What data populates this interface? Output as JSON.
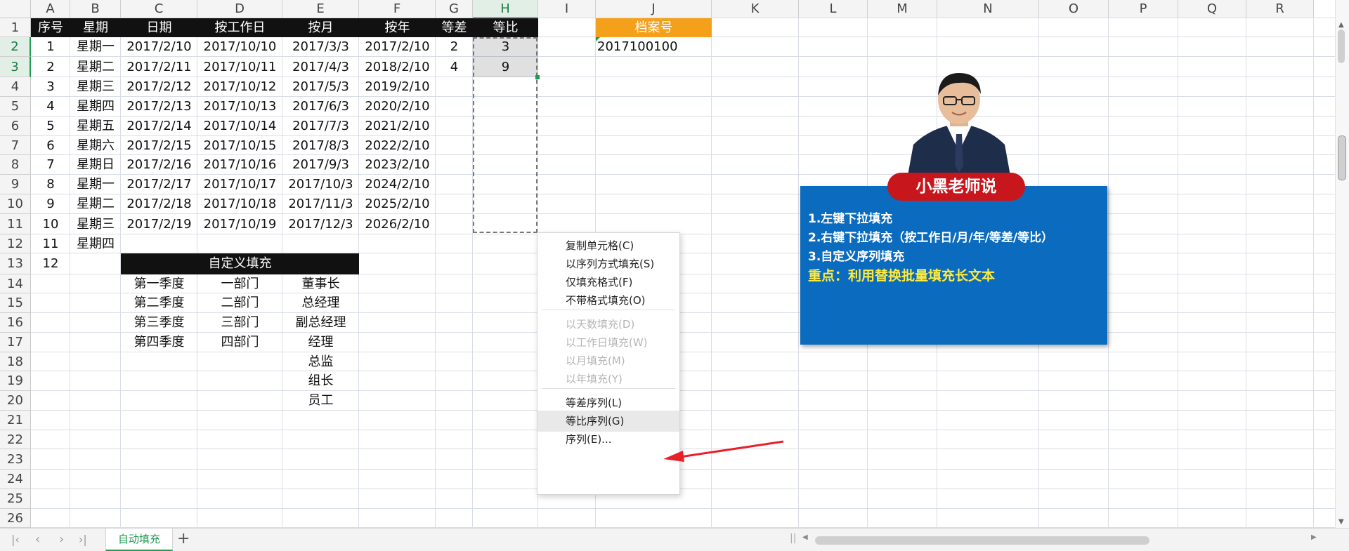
{
  "column_headers": [
    "A",
    "B",
    "C",
    "D",
    "E",
    "F",
    "G",
    "H",
    "I",
    "J",
    "K",
    "L",
    "M",
    "N",
    "O",
    "P",
    "Q",
    "R"
  ],
  "selected_column": "H",
  "row_headers": [
    "1",
    "2",
    "3",
    "4",
    "5",
    "6",
    "7",
    "8",
    "9",
    "10",
    "11",
    "12",
    "13",
    "14",
    "15",
    "16",
    "17",
    "18",
    "19",
    "20",
    "21",
    "22",
    "23",
    "24",
    "25",
    "26"
  ],
  "selected_rows": [
    "2",
    "3"
  ],
  "table_header": [
    "序号",
    "星期",
    "日期",
    "按工作日",
    "按月",
    "按年",
    "等差",
    "等比"
  ],
  "rows": [
    [
      "1",
      "星期一",
      "2017/2/10",
      "2017/10/10",
      "2017/3/3",
      "2017/2/10",
      "2",
      "3"
    ],
    [
      "2",
      "星期二",
      "2017/2/11",
      "2017/10/11",
      "2017/4/3",
      "2018/2/10",
      "4",
      "9"
    ],
    [
      "3",
      "星期三",
      "2017/2/12",
      "2017/10/12",
      "2017/5/3",
      "2019/2/10",
      "",
      ""
    ],
    [
      "4",
      "星期四",
      "2017/2/13",
      "2017/10/13",
      "2017/6/3",
      "2020/2/10",
      "",
      ""
    ],
    [
      "5",
      "星期五",
      "2017/2/14",
      "2017/10/14",
      "2017/7/3",
      "2021/2/10",
      "",
      ""
    ],
    [
      "6",
      "星期六",
      "2017/2/15",
      "2017/10/15",
      "2017/8/3",
      "2022/2/10",
      "",
      ""
    ],
    [
      "7",
      "星期日",
      "2017/2/16",
      "2017/10/16",
      "2017/9/3",
      "2023/2/10",
      "",
      ""
    ],
    [
      "8",
      "星期一",
      "2017/2/17",
      "2017/10/17",
      "2017/10/3",
      "2024/2/10",
      "",
      ""
    ],
    [
      "9",
      "星期二",
      "2017/2/18",
      "2017/10/18",
      "2017/11/3",
      "2025/2/10",
      "",
      ""
    ],
    [
      "10",
      "星期三",
      "2017/2/19",
      "2017/10/19",
      "2017/12/3",
      "2026/2/10",
      "",
      ""
    ],
    [
      "11",
      "星期四",
      "",
      "",
      "",
      "",
      "",
      ""
    ],
    [
      "12",
      "",
      "",
      "",
      "",
      "",
      "",
      ""
    ]
  ],
  "custom_fill": {
    "title": "自定义填充",
    "col1": [
      "第一季度",
      "第二季度",
      "第三季度",
      "第四季度"
    ],
    "col2": [
      "一部门",
      "二部门",
      "三部门",
      "四部门"
    ],
    "col3": [
      "董事长",
      "总经理",
      "副总经理",
      "经理",
      "总监",
      "组长",
      "员工"
    ]
  },
  "archive": {
    "header": "档案号",
    "value": "2017100100"
  },
  "context_menu": {
    "items": [
      {
        "label": "复制单元格(C)",
        "disabled": false
      },
      {
        "label": "以序列方式填充(S)",
        "disabled": false
      },
      {
        "label": "仅填充格式(F)",
        "disabled": false
      },
      {
        "label": "不带格式填充(O)",
        "disabled": false
      },
      {
        "label": "以天数填充(D)",
        "disabled": true
      },
      {
        "label": "以工作日填充(W)",
        "disabled": true
      },
      {
        "label": "以月填充(M)",
        "disabled": true
      },
      {
        "label": "以年填充(Y)",
        "disabled": true
      },
      {
        "label": "等差序列(L)",
        "disabled": false
      },
      {
        "label": "等比序列(G)",
        "disabled": false,
        "highlighted": true
      },
      {
        "label": "序列(E)...",
        "disabled": false
      }
    ]
  },
  "card": {
    "title": "小黑老师说",
    "lines": [
      "1.左键下拉填充",
      "2.右键下拉填充（按工作日/月/年/等差/等比）",
      "3.自定义序列填充"
    ],
    "highlight": "重点：利用替换批量填充长文本"
  },
  "sheet_tabs": [
    "自动填充"
  ],
  "colors": {
    "header_fill": "#111111",
    "archive_fill": "#f5a01a",
    "card_bg": "#0b6bbf",
    "card_title_bg": "#c8161d",
    "highlight_text": "#ffeb3b",
    "accent_green": "#1f9a52",
    "arrow_red": "#e8202a"
  },
  "icons": [
    "first-sheet-icon",
    "prev-sheet-icon",
    "next-sheet-icon",
    "last-sheet-icon",
    "add-sheet-icon",
    "scroll-left-icon",
    "scroll-right-icon",
    "scroll-up-icon",
    "scroll-down-icon",
    "red-arrow-icon",
    "fill-handle-icon"
  ]
}
